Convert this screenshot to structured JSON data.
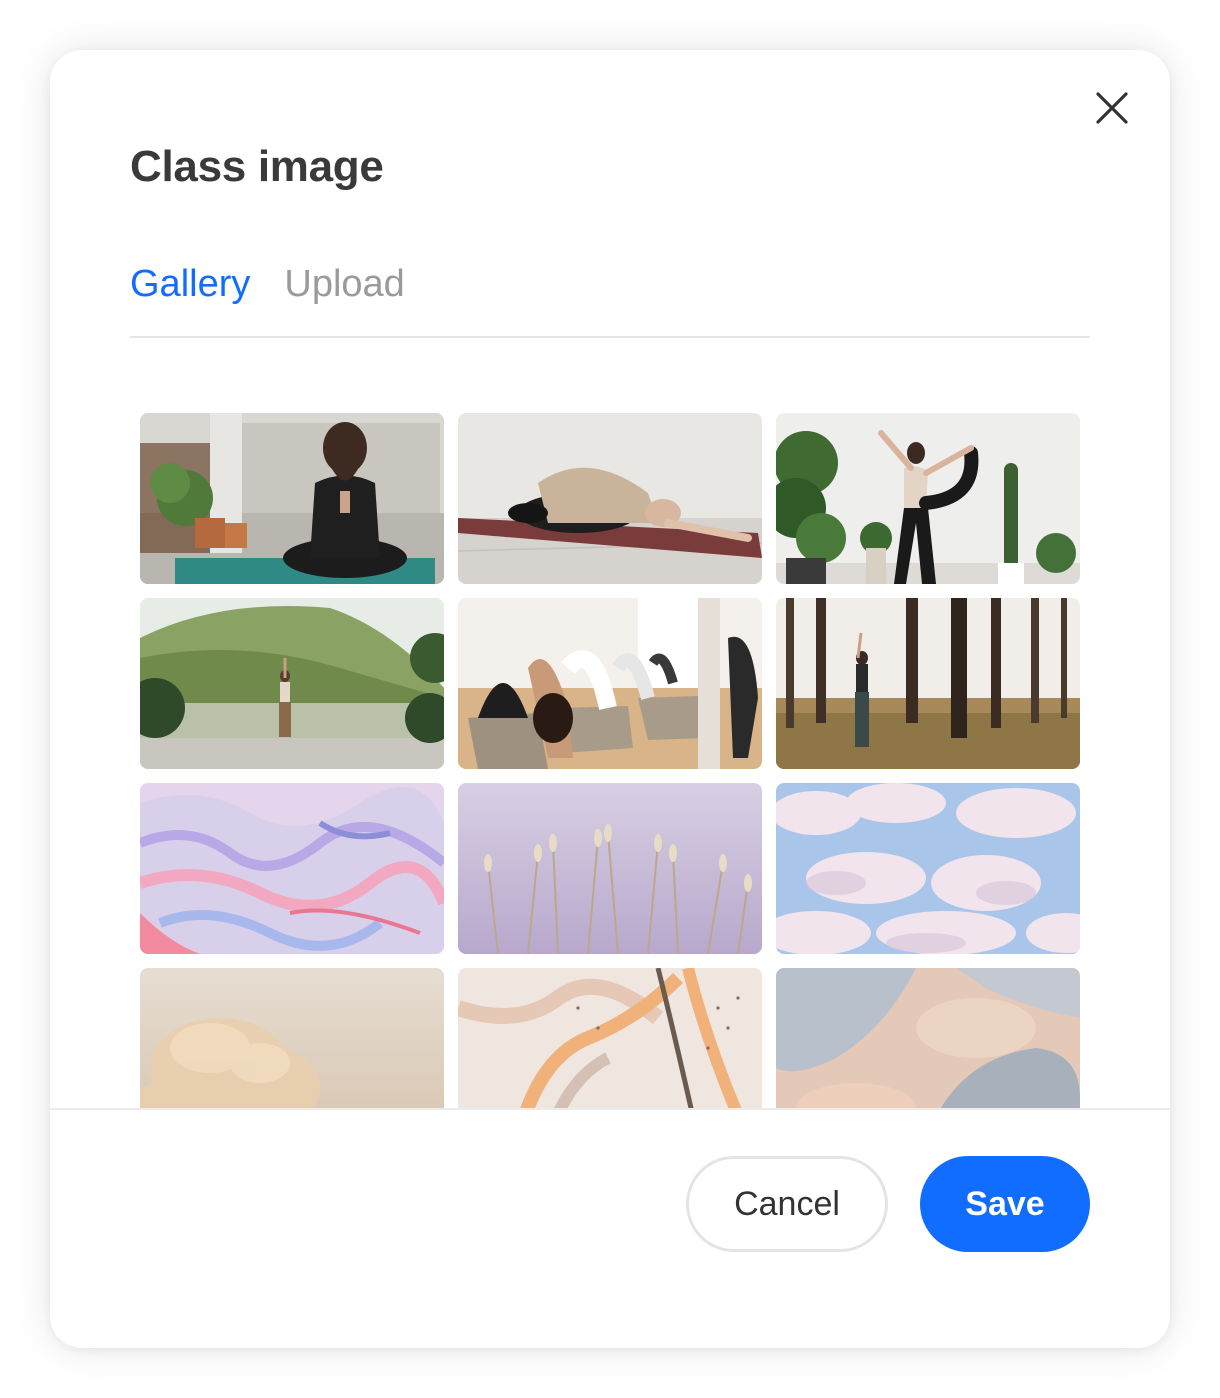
{
  "dialog": {
    "title": "Class image",
    "close_icon": "close-icon"
  },
  "tabs": [
    {
      "label": "Gallery",
      "active": true
    },
    {
      "label": "Upload",
      "active": false
    }
  ],
  "gallery": {
    "thumbnails": [
      {
        "id": "yoga-meditation-balcony"
      },
      {
        "id": "yoga-childs-pose"
      },
      {
        "id": "yoga-dancer-pose"
      },
      {
        "id": "yoga-tree-pose-lake"
      },
      {
        "id": "yoga-class-forward-fold"
      },
      {
        "id": "yoga-forest-pose"
      },
      {
        "id": "pastel-marble-pink"
      },
      {
        "id": "lavender-grass"
      },
      {
        "id": "pastel-clouds"
      },
      {
        "id": "dried-pampas"
      },
      {
        "id": "peach-marble"
      },
      {
        "id": "soft-smoke"
      }
    ]
  },
  "footer": {
    "cancel_label": "Cancel",
    "save_label": "Save"
  },
  "colors": {
    "accent": "#116dff",
    "title": "#3a3a3a",
    "inactive_tab": "#9a9a9a"
  }
}
